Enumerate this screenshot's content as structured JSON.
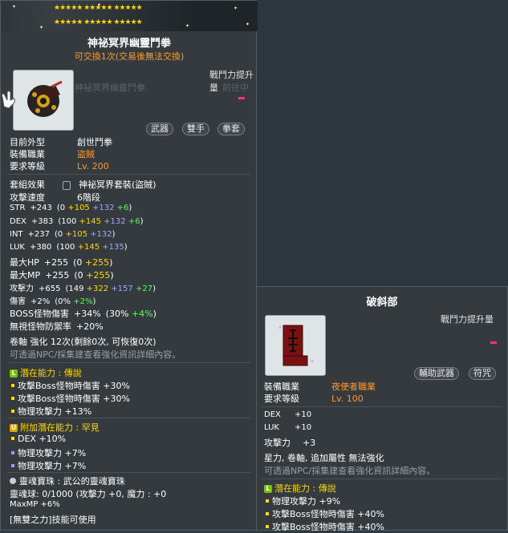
{
  "left": {
    "star_rows": [
      "★★★★★ ★★★★★ ★★★★★",
      "★★★★★ ★★★★★ ★★★★★"
    ],
    "title": "神祕冥界幽靈鬥拳",
    "subtitle": "可交換1次(交易後無法交換)",
    "cp_label": "戰鬥力提升量",
    "tags": [
      "武器",
      "雙手",
      "拳套"
    ],
    "info": [
      {
        "k": "目前外型",
        "v": "創世鬥拳",
        "c": ""
      },
      {
        "k": "裝備職業",
        "v": "盜賊",
        "c": "or"
      },
      {
        "k": "要求等級",
        "v": "Lv. 200",
        "c": "or"
      }
    ],
    "set_effect": {
      "k": "套組效果",
      "v": "神祕冥界套裝(盜賊)"
    },
    "attack_speed": {
      "k": "攻擊速度",
      "v": "6階段"
    },
    "stats": [
      {
        "k": "STR",
        "total": "+243",
        "parts": [
          [
            "(0 ",
            ""
          ],
          [
            "+105 ",
            "y"
          ],
          [
            "+132 ",
            "bl"
          ],
          [
            "+6",
            "gr"
          ],
          [
            ")",
            ""
          ]
        ]
      },
      {
        "k": "DEX",
        "total": "+383",
        "parts": [
          [
            "(100 ",
            ""
          ],
          [
            "+145 ",
            "y"
          ],
          [
            "+132 ",
            "bl"
          ],
          [
            "+6",
            "gr"
          ],
          [
            ")",
            ""
          ]
        ]
      },
      {
        "k": "INT",
        "total": "+237",
        "parts": [
          [
            "(0 ",
            ""
          ],
          [
            "+105 ",
            "y"
          ],
          [
            "+132",
            "bl"
          ],
          [
            ")",
            ""
          ]
        ]
      },
      {
        "k": "LUK",
        "total": "+380",
        "parts": [
          [
            "(100 ",
            ""
          ],
          [
            "+145 ",
            "y"
          ],
          [
            "+135",
            "bl"
          ],
          [
            ")",
            ""
          ]
        ]
      },
      {
        "k": "最大HP",
        "total": "+255",
        "parts": [
          [
            "(0 ",
            ""
          ],
          [
            "+255",
            "y"
          ],
          [
            ")",
            ""
          ]
        ]
      },
      {
        "k": "最大MP",
        "total": "+255",
        "parts": [
          [
            "(0 ",
            ""
          ],
          [
            "+255",
            "y"
          ],
          [
            ")",
            ""
          ]
        ]
      },
      {
        "k": "攻擊力",
        "total": "+655",
        "parts": [
          [
            "(149 ",
            ""
          ],
          [
            "+322 ",
            "y"
          ],
          [
            "+157 ",
            "bl"
          ],
          [
            "+27",
            "gr"
          ],
          [
            ")",
            ""
          ]
        ]
      },
      {
        "k": "傷害",
        "total": "+2%",
        "parts": [
          [
            "(0% ",
            ""
          ],
          [
            "+2%",
            "gr"
          ],
          [
            ")",
            ""
          ]
        ]
      },
      {
        "k": "BOSS怪物傷害",
        "total": "+34%",
        "parts": [
          [
            "(30% ",
            ""
          ],
          [
            "+4%",
            "gr"
          ],
          [
            ")",
            ""
          ]
        ]
      },
      {
        "k": "無視怪物防禦率",
        "total": "+20%",
        "parts": []
      }
    ],
    "scroll_line": "卷軸 強化 12次(剩餘0次, 可恢復0次)",
    "hint": "可透過NPC/採集建查看強化資訊詳細內容。",
    "potential_title": "潛在能力 : 傳說",
    "potential": [
      "攻擊Boss怪物時傷害 +30%",
      "攻擊Boss怪物時傷害 +30%",
      "物理攻擊力 +13%"
    ],
    "add_potential_title": "附加潛在能力 : 罕見",
    "add_potential": [
      "DEX +10%",
      "物理攻擊力 +7%",
      "物理攻擊力 +7%"
    ],
    "soul_title": "靈魂寶珠 : 武公的靈魂寶珠",
    "soul_line": "靈魂球: 0/1000 (攻擊力 +0, 魔力 : +0",
    "maxmp": "MaxMP +6%",
    "skill_line": "[無雙之力]技能可使用",
    "ghost": [
      "神祕冥界幽靈鬥拳",
      "前往中"
    ]
  },
  "right": {
    "title": "破斜部",
    "cp_label": "戰鬥力提升量",
    "tags": [
      "輔助武器",
      "符咒"
    ],
    "info": [
      {
        "k": "裝備職業",
        "v": "夜使者職業",
        "c": "or"
      },
      {
        "k": "要求等級",
        "v": "Lv. 100",
        "c": "or"
      }
    ],
    "stats": [
      {
        "k": "DEX",
        "v": "+10"
      },
      {
        "k": "LUK",
        "v": "+10"
      },
      {
        "k": "攻擊力",
        "v": "+3"
      }
    ],
    "note": "星力, 卷軸, 追加屬性 無法強化",
    "hint": "可透過NPC/採集建查看強化資訊詳細內容。",
    "potential_title": "潛在能力 : 傳說",
    "potential": [
      "物理攻擊力 +9%",
      "攻擊Boss怪物時傷害 +40%",
      "攻擊Boss怪物時傷害 +40%"
    ]
  }
}
